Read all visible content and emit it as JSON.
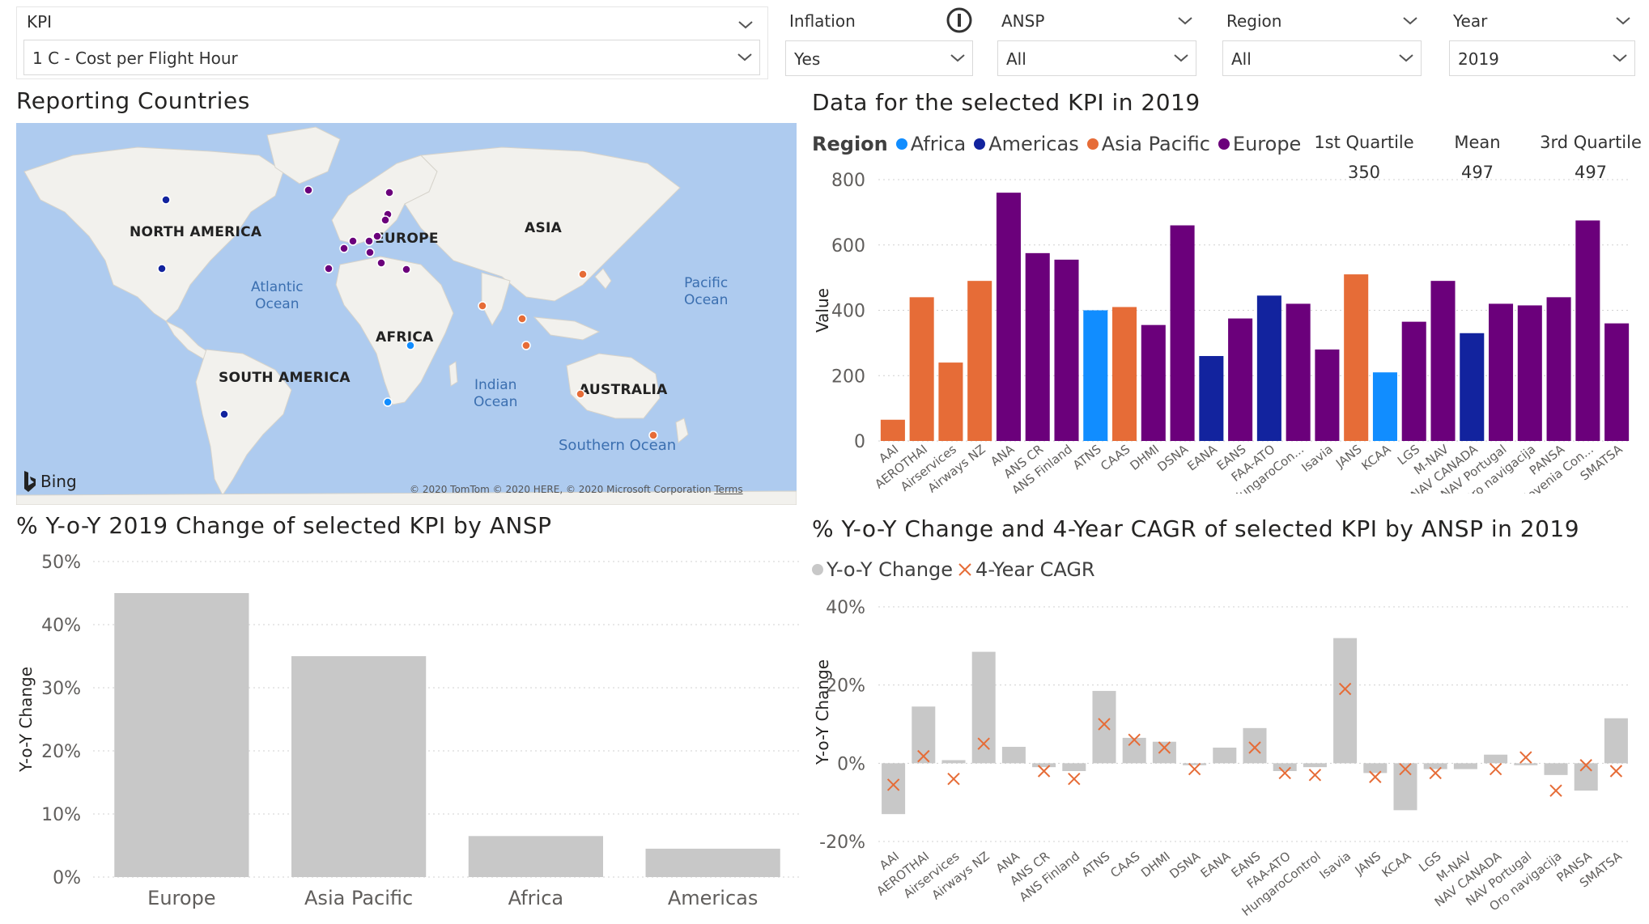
{
  "filters": {
    "kpi": {
      "label": "KPI",
      "value": "1 C - Cost per Flight Hour"
    },
    "inflation": {
      "label": "Inflation",
      "value": "Yes"
    },
    "ansp": {
      "label": "ANSP",
      "value": "All"
    },
    "region": {
      "label": "Region",
      "value": "All"
    },
    "year": {
      "label": "Year",
      "value": "2019"
    }
  },
  "map": {
    "title": "Reporting Countries",
    "labels": {
      "north_america": "NORTH AMERICA",
      "europe": "EUROPE",
      "asia": "ASIA",
      "africa": "AFRICA",
      "south_america": "SOUTH AMERICA",
      "australia": "AUSTRALIA"
    },
    "oceans": {
      "atlantic_1": "Atlantic",
      "atlantic_2": "Ocean",
      "pacific_1": "Pacific",
      "pacific_2": "Ocean",
      "indian_1": "Indian",
      "indian_2": "Ocean",
      "southern": "Southern Ocean"
    },
    "bing": "Bing",
    "copyright": "© 2020 TomTom © 2020 HERE, © 2020 Microsoft Corporation",
    "terms": "Terms"
  },
  "colors": {
    "Africa": "#118dff",
    "Americas": "#12239e",
    "Asia Pacific": "#e66c37",
    "Europe": "#6b007b",
    "grey_bar": "#c8c8c8",
    "cagr_marker": "#e66c37"
  },
  "charts_text": {
    "kpi_chart_title": "Data for the selected KPI in 2019",
    "legend_title": "Region",
    "stats": [
      {
        "label": "1st Quartile",
        "value": "350"
      },
      {
        "label": "Mean",
        "value": "497"
      },
      {
        "label": "3rd Quartile",
        "value": "497"
      }
    ],
    "yoy_region_title": "% Y-o-Y 2019 Change of selected KPI by ANSP",
    "yoy_ansp_title": "% Y-o-Y Change and 4-Year CAGR of selected KPI by ANSP in 2019",
    "yoy_legend": [
      "Y-o-Y Change",
      "4-Year CAGR"
    ]
  },
  "chart_data": [
    {
      "type": "bar",
      "title": "Data for the selected KPI in 2019",
      "ylabel": "Value",
      "ylim": [
        0,
        800
      ],
      "yticks": [
        0,
        200,
        400,
        600,
        800
      ],
      "legend": [
        "Africa",
        "Americas",
        "Asia Pacific",
        "Europe"
      ],
      "categories": [
        "AAI",
        "AEROTHAI",
        "Airservices",
        "Airways NZ",
        "ANA",
        "ANS CR",
        "ANS Finland",
        "ATNS",
        "CAAS",
        "DHMI",
        "DSNA",
        "EANA",
        "EANS",
        "FAA-ATO",
        "HungaroCon...",
        "Isavia",
        "JANS",
        "KCAA",
        "LGS",
        "M-NAV",
        "NAV CANADA",
        "NAV Portugal",
        "Oro navigacija",
        "PANSA",
        "Slovenia Con...",
        "SMATSA"
      ],
      "values": [
        65,
        440,
        240,
        490,
        760,
        575,
        555,
        400,
        410,
        355,
        660,
        260,
        375,
        445,
        420,
        280,
        510,
        210,
        365,
        490,
        330,
        420,
        415,
        440,
        675,
        360
      ],
      "regions": [
        "Asia Pacific",
        "Asia Pacific",
        "Asia Pacific",
        "Asia Pacific",
        "Europe",
        "Europe",
        "Europe",
        "Africa",
        "Asia Pacific",
        "Europe",
        "Europe",
        "Americas",
        "Europe",
        "Americas",
        "Europe",
        "Europe",
        "Asia Pacific",
        "Africa",
        "Europe",
        "Europe",
        "Americas",
        "Europe",
        "Europe",
        "Europe",
        "Europe",
        "Europe"
      ]
    },
    {
      "type": "bar",
      "title": "% Y-o-Y 2019 Change of selected KPI by ANSP",
      "ylabel": "Y-o-Y Change",
      "ylim": [
        0,
        50
      ],
      "yticks": [
        "0%",
        "10%",
        "20%",
        "30%",
        "40%",
        "50%"
      ],
      "categories": [
        "Europe",
        "Asia Pacific",
        "Africa",
        "Americas"
      ],
      "values": [
        45,
        35,
        6.5,
        4.5
      ]
    },
    {
      "type": "bar",
      "title": "% Y-o-Y Change and 4-Year CAGR of selected KPI by ANSP in 2019",
      "ylabel": "Y-o-Y Change",
      "ylim": [
        -20,
        40
      ],
      "yticks": [
        "-20%",
        "0%",
        "20%",
        "40%"
      ],
      "categories": [
        "AAI",
        "AEROTHAI",
        "Airservices",
        "Airways NZ",
        "ANA",
        "ANS CR",
        "ANS Finland",
        "ATNS",
        "CAAS",
        "DHMI",
        "DSNA",
        "EANA",
        "EANS",
        "FAA-ATO",
        "HungaroControl",
        "Isavia",
        "JANS",
        "KCAA",
        "LGS",
        "M-NAV",
        "NAV CANADA",
        "NAV Portugal",
        "Oro navigacija",
        "PANSA",
        "SMATSA"
      ],
      "series": [
        {
          "name": "Y-o-Y Change",
          "values": [
            -13,
            14.5,
            0.8,
            28.5,
            4.2,
            -1,
            -2,
            18.5,
            6.5,
            5.5,
            -0.5,
            4,
            9,
            -2,
            -1,
            32,
            -2.5,
            -12,
            -1.5,
            -1.5,
            2.2,
            -0.5,
            -3,
            -7,
            11.5
          ]
        },
        {
          "name": "4-Year CAGR",
          "values": [
            -5.5,
            1.8,
            -4,
            5,
            null,
            -2,
            -4,
            10,
            6,
            4,
            -1.5,
            null,
            4,
            -2.5,
            -3,
            19,
            -3.5,
            -1.5,
            -2.5,
            null,
            -1.5,
            1.5,
            -7,
            -0.5,
            -2
          ]
        }
      ]
    }
  ]
}
